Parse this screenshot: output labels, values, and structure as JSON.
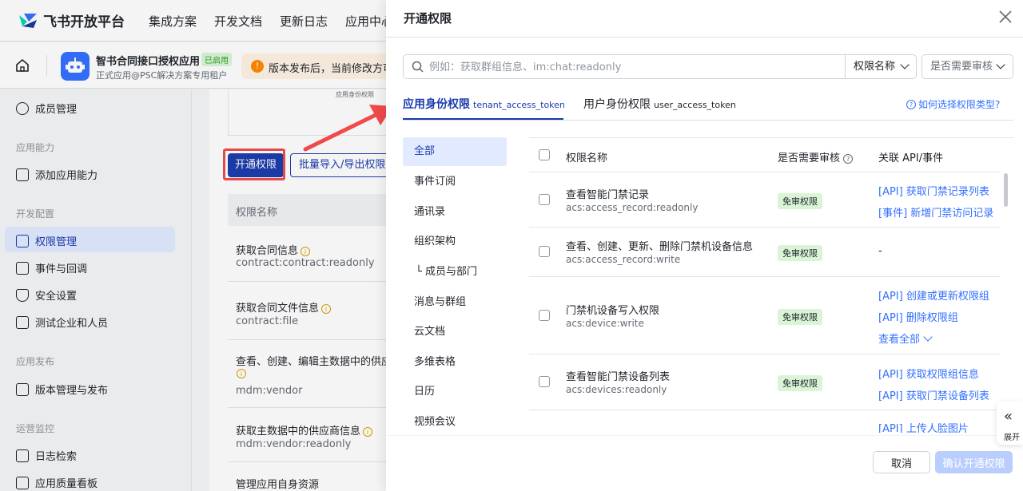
{
  "brand": {
    "name": "飞书开放平台"
  },
  "nav": [
    "集成方案",
    "开发文档",
    "更新日志",
    "应用中心"
  ],
  "app": {
    "name": "智书合同接口授权应用",
    "badge": "已启用",
    "subtitle": "正式应用@PSC解决方案专用租户"
  },
  "notice": {
    "text": "版本发布后，当前修改方可"
  },
  "sidebar": {
    "items": [
      {
        "label": "成员管理",
        "icon": "members-icon"
      },
      {
        "group": "应用能力"
      },
      {
        "label": "添加应用能力",
        "icon": "grid-icon"
      },
      {
        "group": "开发配置"
      },
      {
        "label": "权限管理",
        "icon": "permission-icon",
        "active": true
      },
      {
        "label": "事件与回调",
        "icon": "event-icon"
      },
      {
        "label": "安全设置",
        "icon": "shield-icon"
      },
      {
        "label": "测试企业和人员",
        "icon": "test-icon"
      },
      {
        "group": "应用发布"
      },
      {
        "label": "版本管理与发布",
        "icon": "release-icon"
      },
      {
        "group": "运营监控"
      },
      {
        "label": "日志检索",
        "icon": "log-icon"
      },
      {
        "label": "应用质量看板",
        "icon": "quality-icon"
      }
    ]
  },
  "bg_main": {
    "image_label": "应用身份权限",
    "open_button": "开通权限",
    "import_button": "批量导入/导出权限",
    "table_header": "权限名称",
    "rows": [
      {
        "title": "获取合同信息",
        "code": "contract:contract:readonly"
      },
      {
        "title": "获取合同文件信息",
        "code": "contract:file"
      },
      {
        "title": "查看、创建、编辑主数据中的供应",
        "code": "mdm:vendor"
      },
      {
        "title": "获取主数据中的供应商信息",
        "code": "mdm:vendor:readonly"
      },
      {
        "title": "管理应用自身资源",
        "code": ""
      }
    ]
  },
  "drawer": {
    "title": "开通权限",
    "search": {
      "placeholder": "例如：获取群组信息、im:chat:readonly",
      "field": "权限名称",
      "review_filter": "是否需要审核"
    },
    "tabs": [
      {
        "label": "应用身份权限",
        "sub": "tenant_access_token",
        "active": true
      },
      {
        "label": "用户身份权限",
        "sub": "user_access_token",
        "active": false
      }
    ],
    "help_link": "如何选择权限类型?",
    "categories": [
      "全部",
      "事件订阅",
      "通讯录",
      "组织架构",
      "└ 成员与部门",
      "消息与群组",
      "云文档",
      "多维表格",
      "日历",
      "视频会议"
    ],
    "table": {
      "headers": {
        "name": "权限名称",
        "review": "是否需要审核",
        "api": "关联 API/事件"
      },
      "rows": [
        {
          "title": "查看智能门禁记录",
          "code": "acs:access_record:readonly",
          "review": "免审权限",
          "apis": [
            "[API] 获取门禁记录列表",
            "[事件] 新增门禁访问记录"
          ]
        },
        {
          "title": "查看、创建、更新、删除门禁机设备信息",
          "code": "acs:access_record:write",
          "review": "免审权限",
          "apis": [],
          "dash": "-"
        },
        {
          "title": "门禁机设备写入权限",
          "code": "acs:device:write",
          "review": "免审权限",
          "apis": [
            "[API] 创建或更新权限组",
            "[API] 删除权限组"
          ],
          "more": "查看全部"
        },
        {
          "title": "查看智能门禁设备列表",
          "code": "acs:devices:readonly",
          "review": "免审权限",
          "apis": [
            "[API] 获取权限组信息",
            "[API] 获取门禁设备列表"
          ]
        },
        {
          "title": "",
          "code": "",
          "review": "",
          "apis": [
            "[API] 上传人脸图片"
          ]
        }
      ]
    },
    "footer": {
      "cancel": "取消",
      "confirm": "确认开通权限"
    }
  },
  "expand_tab": {
    "label": "展开",
    "glyph": "«"
  },
  "colors": {
    "primary": "#1a3bac",
    "link": "#3370ff",
    "badge_bg": "#d9f5d6",
    "highlight": "#f04a4a"
  }
}
